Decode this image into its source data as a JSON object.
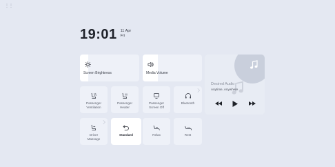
{
  "corner_mark": "⋮⋮",
  "clock": {
    "time": "19:01",
    "date": "11 Apr",
    "day": "Fri"
  },
  "sliders": [
    {
      "id": "brightness",
      "label": "Screen Brightness",
      "icon": "sun-icon",
      "level_percent": 14
    },
    {
      "id": "volume",
      "label": "Media Volume",
      "icon": "speaker-icon",
      "level_percent": 26
    }
  ],
  "row2": [
    {
      "label": "Passenger\nVentilation",
      "icon": "seat-ventilation-icon",
      "active": false
    },
    {
      "label": "Passenger\nHeater",
      "icon": "seat-heater-icon",
      "active": false
    },
    {
      "label": "Passenger\nScreen Off",
      "icon": "screen-off-icon",
      "active": false
    },
    {
      "label": "Bluetooth",
      "icon": "headphones-icon",
      "active": false
    }
  ],
  "row3": [
    {
      "label": "Driver\nMassage",
      "icon": "massage-seat-icon",
      "active": false
    },
    {
      "label": "Standard",
      "icon": "undo-arrow-icon",
      "active": true
    },
    {
      "label": "Relax",
      "icon": "relax-seat-icon",
      "active": false
    },
    {
      "label": "Rest",
      "icon": "rest-seat-icon",
      "active": false
    }
  ],
  "media": {
    "title": "Desired Audio",
    "subtitle": "Anytime, Anywhere",
    "controls": [
      "previous-icon",
      "play-icon",
      "next-icon"
    ]
  },
  "colors": {
    "background": "#e4e8f2",
    "tile": "#eef1f8",
    "active_tile": "#ffffff",
    "text": "#2a2d36"
  }
}
